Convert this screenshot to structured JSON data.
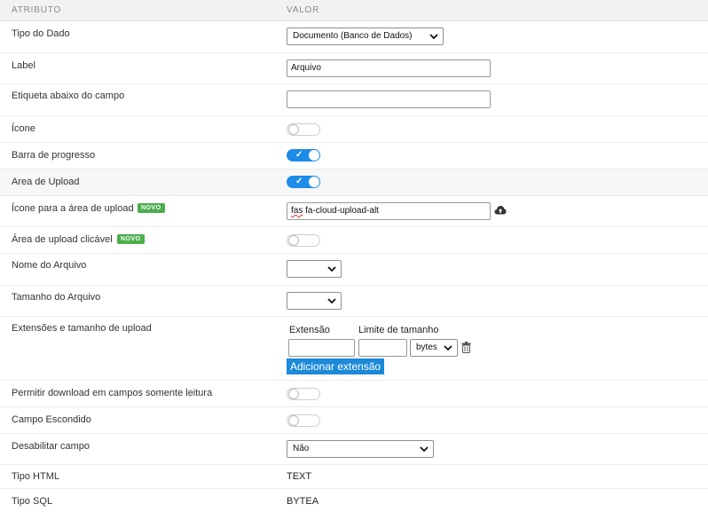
{
  "header": {
    "col_attr": "ATRIBUTO",
    "col_val": "VALOR"
  },
  "rows": {
    "tipo_dado": {
      "label": "Tipo do Dado",
      "value": "Documento (Banco de Dados)"
    },
    "label": {
      "label": "Label",
      "value": "Arquivo"
    },
    "etiqueta": {
      "label": "Etiqueta abaixo do campo",
      "value": ""
    },
    "icone": {
      "label": "Ícone",
      "on": false
    },
    "barra": {
      "label": "Barra de progresso",
      "on": true
    },
    "area_upload": {
      "label": "Area de Upload",
      "on": true
    },
    "icone_area": {
      "label": "Ícone para a área de upload",
      "badge": "NOVO",
      "value_a": "fas",
      "value_b": " fa-cloud-upload-alt"
    },
    "area_click": {
      "label": "Área de upload clicável",
      "badge": "NOVO",
      "on": false
    },
    "nome_arquivo": {
      "label": "Nome do Arquivo",
      "value": ""
    },
    "tamanho_arquivo": {
      "label": "Tamanho do Arquivo",
      "value": ""
    },
    "extensoes": {
      "label": "Extensões e tamanho de upload",
      "col_ext": "Extensão",
      "col_lim": "Limite de tamanho",
      "ext_value": "",
      "lim_value": "",
      "unit": "bytes",
      "add_button": "Adicionar extensão"
    },
    "permitir": {
      "label": "Permitir download em campos somente leitura",
      "on": false
    },
    "escondido": {
      "label": "Campo Escondido",
      "on": false
    },
    "desabilitar": {
      "label": "Desabilitar campo",
      "value": "Não"
    },
    "tipo_html": {
      "label": "Tipo HTML",
      "value": "TEXT"
    },
    "tipo_sql": {
      "label": "Tipo SQL",
      "value": "BYTEA"
    }
  }
}
